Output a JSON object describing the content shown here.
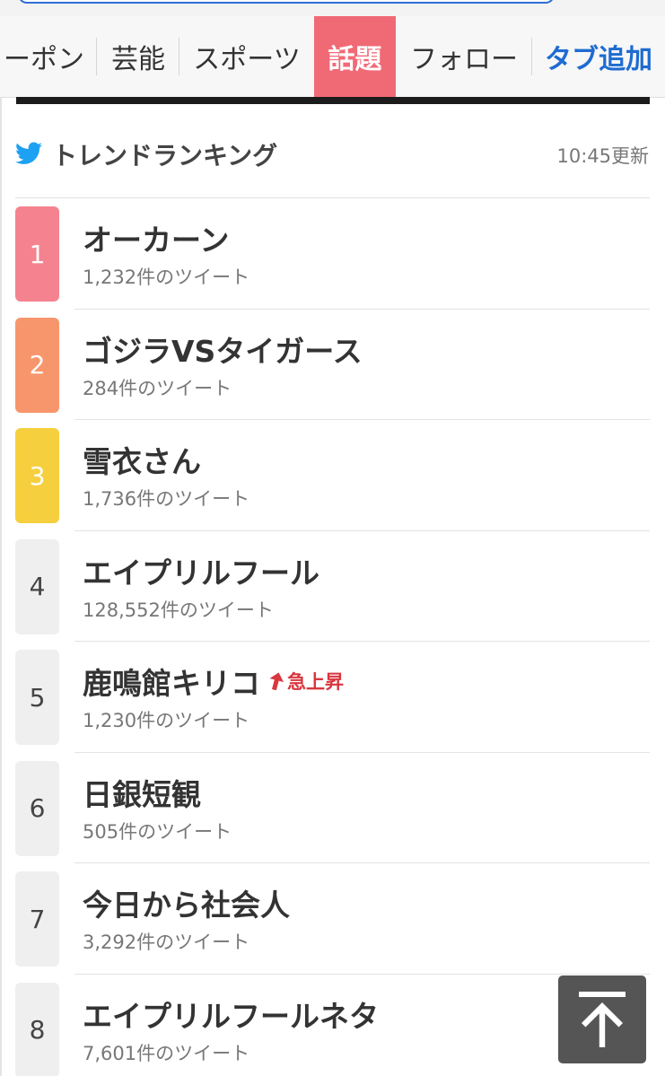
{
  "tabs": [
    {
      "label": "ーポン",
      "active": false
    },
    {
      "label": "芸能",
      "active": false
    },
    {
      "label": "スポーツ",
      "active": false
    },
    {
      "label": "話題",
      "active": true
    },
    {
      "label": "フォロー",
      "active": false
    },
    {
      "label": "タブ追加",
      "active": false
    }
  ],
  "trend": {
    "title": "トレンドランキング",
    "updated": "10:45更新",
    "icon": "twitter-bird-icon"
  },
  "colors": {
    "rank1": "#f5838f",
    "rank2": "#f7966c",
    "rank3": "#f6cf3e",
    "rank_other": "#efefef",
    "active_tab": "#f06a76",
    "link": "#1f6bd1",
    "rise": "#d9363e",
    "twitter": "#1da1f2"
  },
  "items": [
    {
      "rank": "1",
      "title": "オーカーン",
      "count": "1,232件のツイート"
    },
    {
      "rank": "2",
      "title": "ゴジラVSタイガース",
      "count": "284件のツイート"
    },
    {
      "rank": "3",
      "title": "雪衣さん",
      "count": "1,736件のツイート"
    },
    {
      "rank": "4",
      "title": "エイプリルフール",
      "count": "128,552件のツイート"
    },
    {
      "rank": "5",
      "title": "鹿鳴館キリコ",
      "count": "1,230件のツイート",
      "badge": "急上昇"
    },
    {
      "rank": "6",
      "title": "日銀短観",
      "count": "505件のツイート"
    },
    {
      "rank": "7",
      "title": "今日から社会人",
      "count": "3,292件のツイート"
    },
    {
      "rank": "8",
      "title": "エイプリルフールネタ",
      "count": "7,601件のツイート"
    }
  ],
  "scroll_top": {
    "icon": "arrow-up-to-top-icon"
  }
}
